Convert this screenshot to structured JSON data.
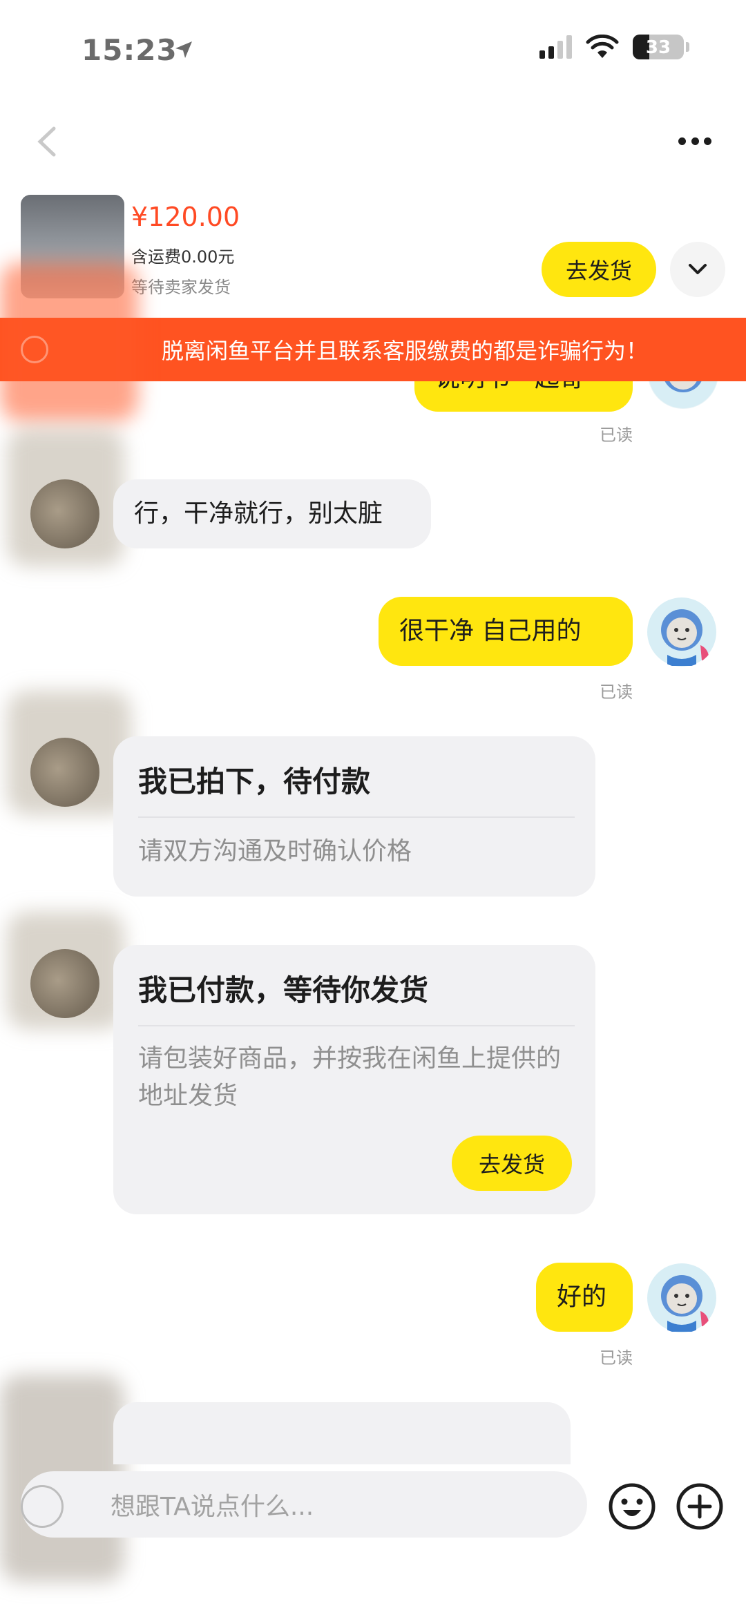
{
  "status_bar": {
    "time": "15:23",
    "battery": "33"
  },
  "product": {
    "price": "¥120.00",
    "shipping": "含运费0.00元",
    "status": "等待卖家发货",
    "ship_button": "去发货"
  },
  "warning": {
    "text": "脱离闲鱼平台并且联系客服缴费的都是诈骗行为！"
  },
  "messages": [
    {
      "from": "me",
      "text": "说明书一起寄",
      "read": "已读"
    },
    {
      "from": "them",
      "text": "行，干净就行，别太脏"
    },
    {
      "from": "me",
      "text": "很干净 自己用的",
      "read": "已读"
    },
    {
      "from": "me",
      "text": "好的",
      "read": "已读"
    }
  ],
  "cards": [
    {
      "title": "我已拍下，待付款",
      "text": "请双方沟通及时确认价格"
    },
    {
      "title": "我已付款，等待你发货",
      "text": "请包装好商品，并按我在闲鱼上提供的地址发货",
      "button": "去发货"
    }
  ],
  "input": {
    "placeholder": "想跟TA说点什么..."
  },
  "colors": {
    "accent_yellow": "#ffe60f",
    "warning_orange": "#ff5321",
    "price_red": "#ff4a24",
    "bubble_gray": "#f1f1f3"
  }
}
